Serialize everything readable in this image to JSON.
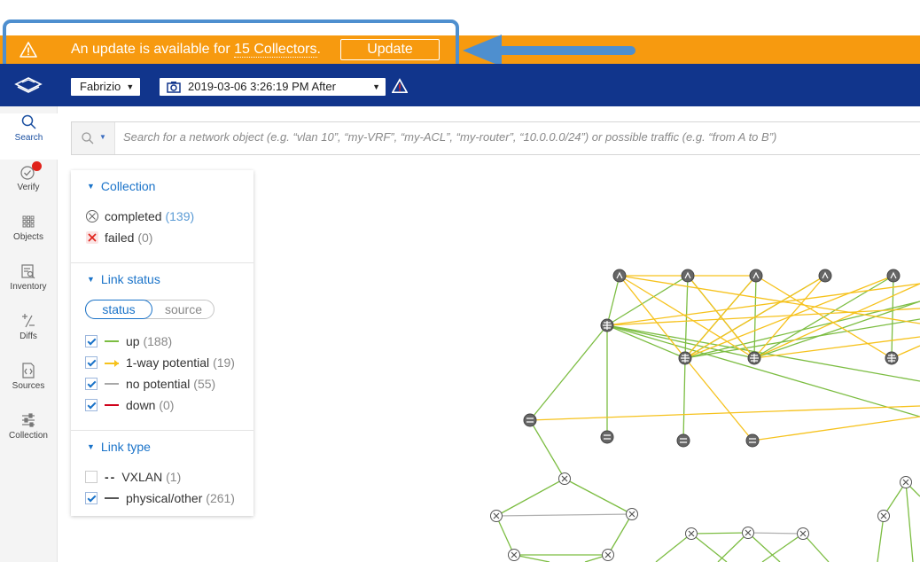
{
  "banner": {
    "message_prefix": "An update is available for ",
    "message_link": "15 Collectors",
    "message_suffix": ".",
    "update_label": "Update",
    "color": "#f79a0f"
  },
  "header": {
    "color": "#11358c",
    "user": "Fabrizio",
    "snapshot": "2019-03-06 3:26:19 PM  After"
  },
  "rail": {
    "items": [
      {
        "label": "Search",
        "icon": "search-icon"
      },
      {
        "label": "Verify",
        "icon": "verify-check-icon"
      },
      {
        "label": "Objects",
        "icon": "objects-grid-icon"
      },
      {
        "label": "Inventory",
        "icon": "inventory-icon"
      },
      {
        "label": "Diffs",
        "icon": "diffs-icon"
      },
      {
        "label": "Sources",
        "icon": "sources-icon"
      },
      {
        "label": "Collection",
        "icon": "collection-sliders-icon"
      }
    ]
  },
  "search": {
    "placeholder": "Search for a network object (e.g. “vlan 10”, “my-VRF”, “my-ACL”, “my-router”, “10.0.0.0/24”) or possible traffic (e.g. “from A to B”)"
  },
  "panel": {
    "collection": {
      "title": "Collection",
      "items": [
        {
          "label": "completed",
          "count": "(139)"
        },
        {
          "label": "failed",
          "count": "(0)"
        }
      ]
    },
    "link_status": {
      "title": "Link status",
      "toggle": [
        "status",
        "source"
      ],
      "items": [
        {
          "label": "up",
          "count": "(188)",
          "color": "#7cbd42",
          "checked": true
        },
        {
          "label": "1-way potential",
          "count": "(19)",
          "color": "#f6c21c",
          "checked": true
        },
        {
          "label": "no potential",
          "count": "(55)",
          "color": "#a8a8a8",
          "checked": true
        },
        {
          "label": "down",
          "count": "(0)",
          "color": "#d0021b",
          "checked": true
        }
      ]
    },
    "link_type": {
      "title": "Link type",
      "items": [
        {
          "label": "VXLAN",
          "count": "(1)",
          "checked": false
        },
        {
          "label": "physical/other",
          "count": "(261)",
          "checked": true
        }
      ]
    }
  }
}
